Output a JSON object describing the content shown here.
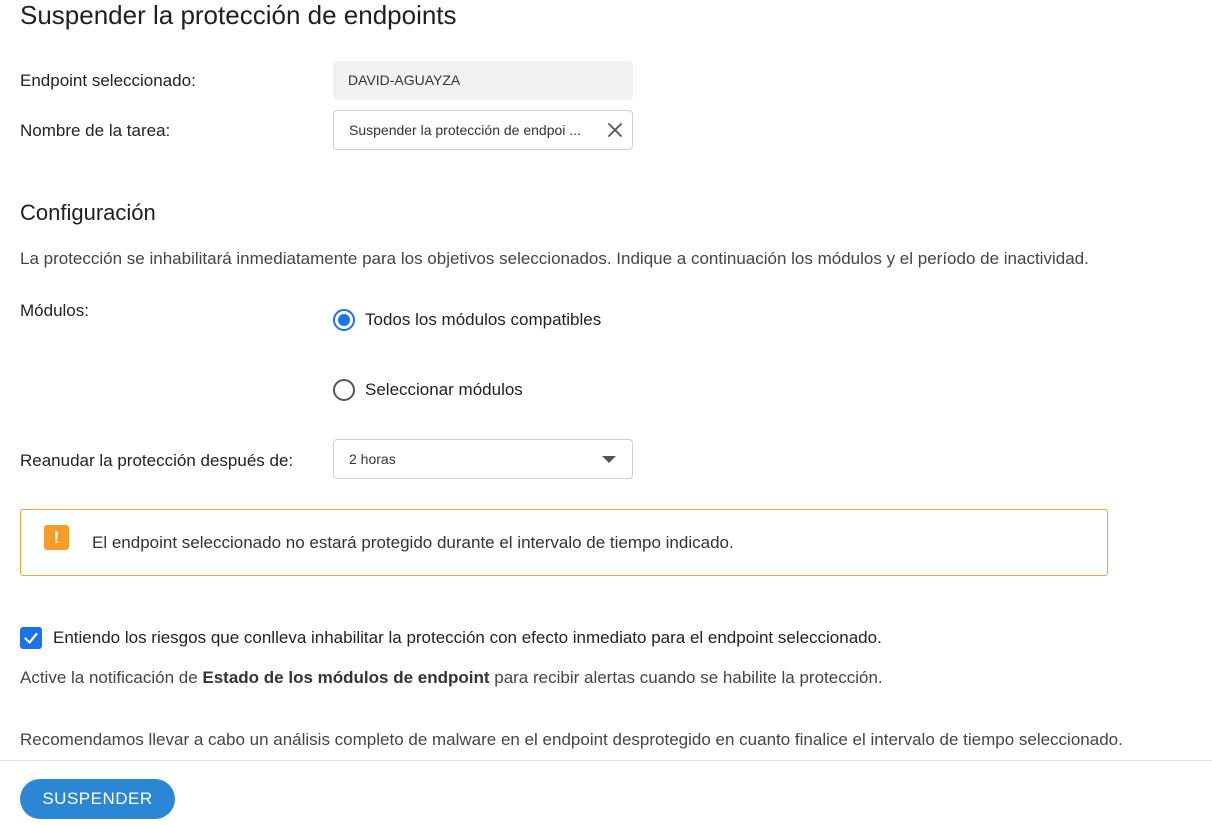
{
  "page": {
    "title": "Suspender la protección de endpoints"
  },
  "form": {
    "endpoint_label": "Endpoint seleccionado:",
    "endpoint_value": "DAVID-AGUAYZA",
    "task_name_label": "Nombre de la tarea:",
    "task_name_value": "Suspender la protección de endpoi ..."
  },
  "configuration": {
    "title": "Configuración",
    "description": "La protección se inhabilitará inmediatamente para los objetivos seleccionados. Indique a continuación los módulos y el período de inactividad.",
    "modules_label": "Módulos:",
    "modules_options": [
      {
        "label": "Todos los módulos compatibles",
        "selected": true
      },
      {
        "label": "Seleccionar módulos",
        "selected": false
      }
    ],
    "resume_label": "Reanudar la protección después de:",
    "resume_value": "2 horas"
  },
  "warning": {
    "icon": "exclamation-icon",
    "text": "El endpoint seleccionado no estará protegido durante el intervalo de tiempo indicado."
  },
  "acknowledge": {
    "checked": true,
    "label": "Entiendo los riesgos que conlleva inhabilitar la protección con efecto inmediato para el endpoint seleccionado."
  },
  "notes": {
    "notification_prefix": "Active la notificación de ",
    "notification_bold": "Estado de los módulos de endpoint",
    "notification_suffix": " para recibir alertas cuando se habilite la protección.",
    "recommendation": "Recomendamos llevar a cabo un análisis completo de malware en el endpoint desprotegido en cuanto finalice el intervalo de tiempo seleccionado."
  },
  "actions": {
    "suspend_label": "SUSPENDER"
  },
  "colors": {
    "accent": "#1a73e8",
    "button": "#2b86d6",
    "warning_border": "#f0a541",
    "warning_icon": "#f59c2b"
  }
}
